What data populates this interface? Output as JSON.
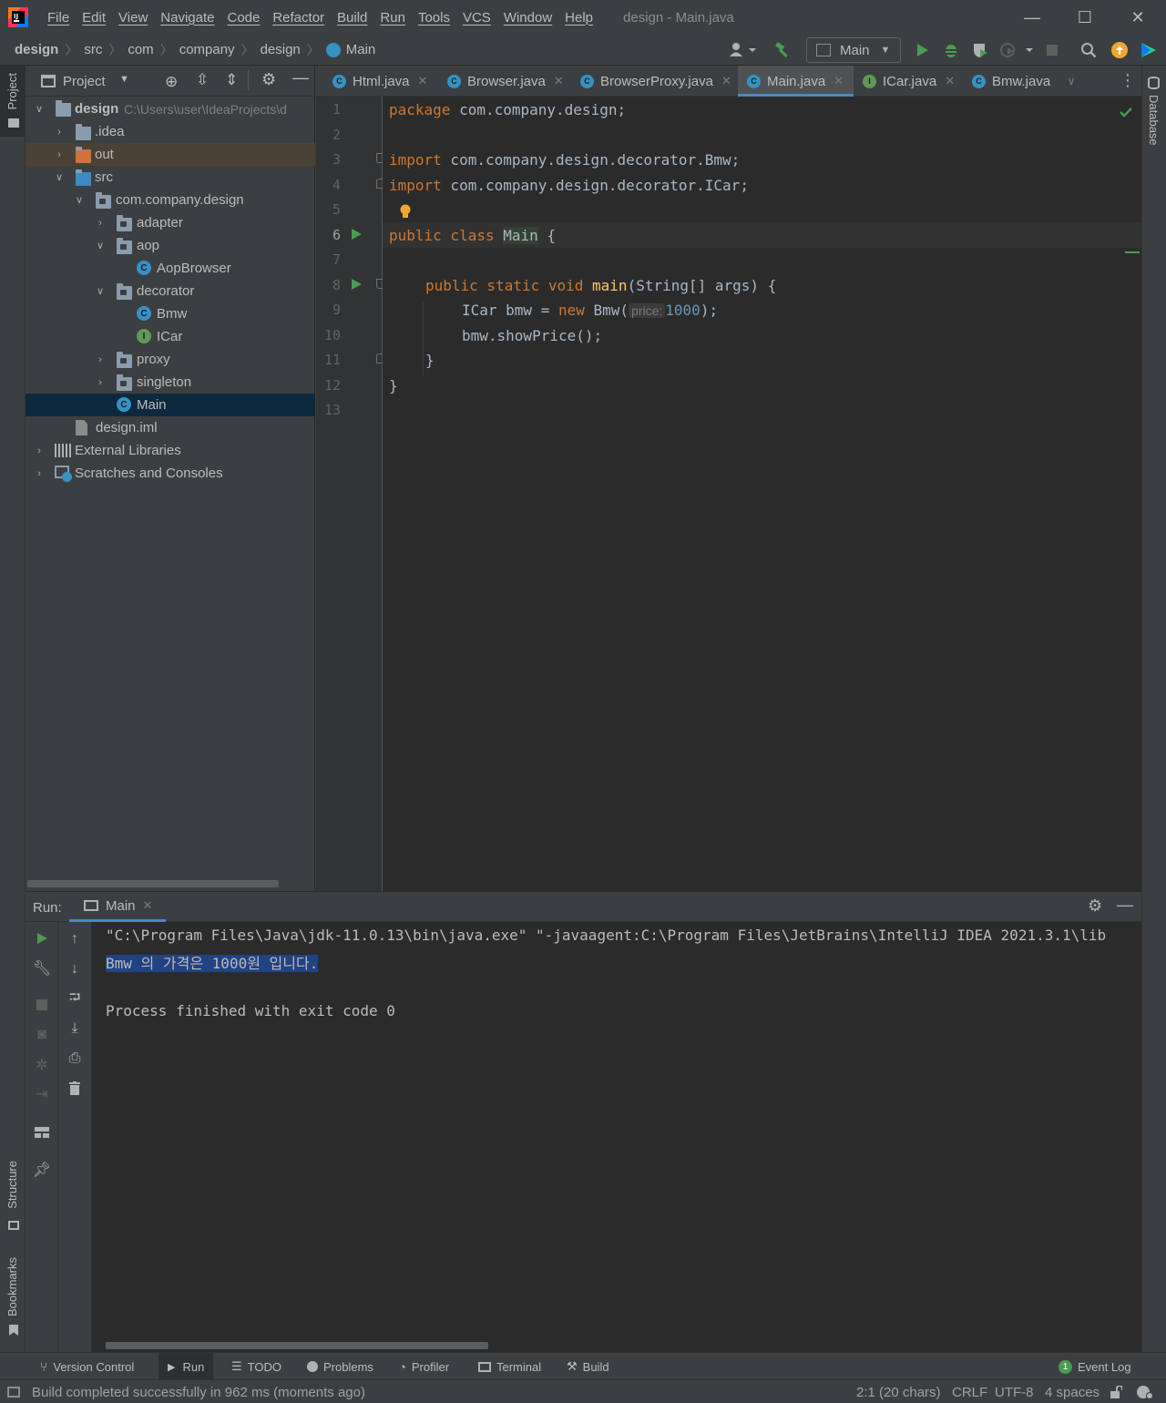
{
  "window": {
    "menu": [
      "File",
      "Edit",
      "View",
      "Navigate",
      "Code",
      "Refactor",
      "Build",
      "Run",
      "Tools",
      "VCS",
      "Window",
      "Help"
    ],
    "title": "design - Main.java",
    "controls": {
      "minimize": "—",
      "maximize": "☐",
      "close": "✕"
    }
  },
  "breadcrumbs": [
    "design",
    "src",
    "com",
    "company",
    "design",
    "Main"
  ],
  "toolbar": {
    "run_config": "Main",
    "icons": [
      "user-icon",
      "hammer-icon",
      "run-icon",
      "debug-icon",
      "coverage-icon",
      "profile-icon",
      "stop-icon",
      "search-icon",
      "update-icon",
      "toolbox-icon"
    ]
  },
  "left_stripe": {
    "project": "Project",
    "structure": "Structure",
    "bookmarks": "Bookmarks"
  },
  "right_stripe": {
    "database": "Database"
  },
  "project_panel": {
    "title": "Project",
    "tree": [
      {
        "label": "design",
        "extra": "C:\\Users\\user\\IdeaProjects\\d",
        "type": "module",
        "expanded": true
      },
      {
        "label": ".idea",
        "type": "folder",
        "expanded": false
      },
      {
        "label": "out",
        "type": "folder-orange",
        "expanded": false
      },
      {
        "label": "src",
        "type": "folder-blue",
        "expanded": true
      },
      {
        "label": "com.company.design",
        "type": "package",
        "expanded": true
      },
      {
        "label": "adapter",
        "type": "package",
        "expanded": false
      },
      {
        "label": "aop",
        "type": "package",
        "expanded": true
      },
      {
        "label": "AopBrowser",
        "type": "class"
      },
      {
        "label": "decorator",
        "type": "package",
        "expanded": true
      },
      {
        "label": "Bmw",
        "type": "class"
      },
      {
        "label": "ICar",
        "type": "interface"
      },
      {
        "label": "proxy",
        "type": "package",
        "expanded": false
      },
      {
        "label": "singleton",
        "type": "package",
        "expanded": false
      },
      {
        "label": "Main",
        "type": "main-class",
        "selected": true
      },
      {
        "label": "design.iml",
        "type": "file"
      },
      {
        "label": "External Libraries",
        "type": "libraries",
        "expanded": false
      },
      {
        "label": "Scratches and Consoles",
        "type": "scratches",
        "expanded": false
      }
    ]
  },
  "editor_tabs": [
    {
      "label": "Html.java",
      "active": false
    },
    {
      "label": "Browser.java",
      "active": false
    },
    {
      "label": "BrowserProxy.java",
      "active": false
    },
    {
      "label": "Main.java",
      "active": true
    },
    {
      "label": "ICar.java",
      "active": false
    },
    {
      "label": "Bmw.java",
      "active": false
    }
  ],
  "editor": {
    "line_numbers": [
      "1",
      "2",
      "3",
      "4",
      "5",
      "6",
      "7",
      "8",
      "9",
      "10",
      "11",
      "12",
      "13"
    ],
    "code": {
      "l1_kw": "package",
      "l1_rest": " com.company.design;",
      "l3_kw": "import",
      "l3_rest": " com.company.design.decorator.Bmw;",
      "l4_kw": "import",
      "l4_rest": " com.company.design.decorator.ICar;",
      "l6_kw": "public class",
      "l6_name": "Main",
      "l6_rest": " {",
      "l8_kw": "public static void",
      "l8_fn": "main",
      "l8_rest": "(String[] args) {",
      "l9_a": "ICar bmw = ",
      "l9_kw": "new",
      "l9_b": " Bmw(",
      "l9_hint": "price:",
      "l9_num": "1000",
      "l9_c": ");",
      "l10": "bmw.showPrice();",
      "l11": "}",
      "l12": "}"
    }
  },
  "run_panel": {
    "label": "Run:",
    "tab": "Main",
    "console": {
      "cmd": "\"C:\\Program Files\\Java\\jdk-11.0.13\\bin\\java.exe\" \"-javaagent:C:\\Program Files\\JetBrains\\IntelliJ IDEA 2021.3.1\\lib",
      "output": "Bmw 의 가격은 1000원 입니다.",
      "exit": "Process finished with exit code 0"
    }
  },
  "bottom_tools": [
    {
      "label": "Version Control",
      "icon": "branch-icon"
    },
    {
      "label": "Run",
      "icon": "run-icon",
      "active": true
    },
    {
      "label": "TODO",
      "icon": "list-icon"
    },
    {
      "label": "Problems",
      "icon": "problems-icon"
    },
    {
      "label": "Profiler",
      "icon": "profiler-icon"
    },
    {
      "label": "Terminal",
      "icon": "terminal-icon"
    },
    {
      "label": "Build",
      "icon": "hammer-icon"
    }
  ],
  "event_log": {
    "count": "1",
    "label": "Event Log"
  },
  "status": {
    "message": "Build completed successfully in 962 ms (moments ago)",
    "position": "2:1 (20 chars)",
    "line_sep": "CRLF",
    "encoding": "UTF-8",
    "indent": "4 spaces"
  },
  "colors": {
    "accent": "#4a88c7",
    "run_green": "#499c54",
    "selection": "#214283"
  }
}
